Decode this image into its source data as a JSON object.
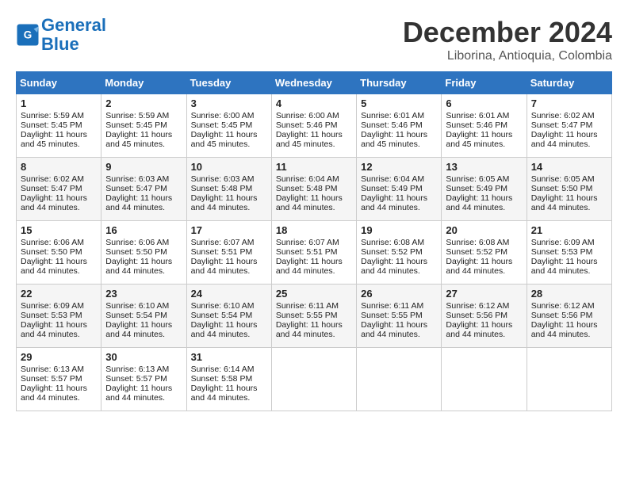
{
  "header": {
    "logo_line1": "General",
    "logo_line2": "Blue",
    "month_title": "December 2024",
    "location": "Liborina, Antioquia, Colombia"
  },
  "weekdays": [
    "Sunday",
    "Monday",
    "Tuesday",
    "Wednesday",
    "Thursday",
    "Friday",
    "Saturday"
  ],
  "weeks": [
    [
      {
        "day": "1",
        "lines": [
          "Sunrise: 5:59 AM",
          "Sunset: 5:45 PM",
          "Daylight: 11 hours",
          "and 45 minutes."
        ]
      },
      {
        "day": "2",
        "lines": [
          "Sunrise: 5:59 AM",
          "Sunset: 5:45 PM",
          "Daylight: 11 hours",
          "and 45 minutes."
        ]
      },
      {
        "day": "3",
        "lines": [
          "Sunrise: 6:00 AM",
          "Sunset: 5:45 PM",
          "Daylight: 11 hours",
          "and 45 minutes."
        ]
      },
      {
        "day": "4",
        "lines": [
          "Sunrise: 6:00 AM",
          "Sunset: 5:46 PM",
          "Daylight: 11 hours",
          "and 45 minutes."
        ]
      },
      {
        "day": "5",
        "lines": [
          "Sunrise: 6:01 AM",
          "Sunset: 5:46 PM",
          "Daylight: 11 hours",
          "and 45 minutes."
        ]
      },
      {
        "day": "6",
        "lines": [
          "Sunrise: 6:01 AM",
          "Sunset: 5:46 PM",
          "Daylight: 11 hours",
          "and 45 minutes."
        ]
      },
      {
        "day": "7",
        "lines": [
          "Sunrise: 6:02 AM",
          "Sunset: 5:47 PM",
          "Daylight: 11 hours",
          "and 44 minutes."
        ]
      }
    ],
    [
      {
        "day": "8",
        "lines": [
          "Sunrise: 6:02 AM",
          "Sunset: 5:47 PM",
          "Daylight: 11 hours",
          "and 44 minutes."
        ]
      },
      {
        "day": "9",
        "lines": [
          "Sunrise: 6:03 AM",
          "Sunset: 5:47 PM",
          "Daylight: 11 hours",
          "and 44 minutes."
        ]
      },
      {
        "day": "10",
        "lines": [
          "Sunrise: 6:03 AM",
          "Sunset: 5:48 PM",
          "Daylight: 11 hours",
          "and 44 minutes."
        ]
      },
      {
        "day": "11",
        "lines": [
          "Sunrise: 6:04 AM",
          "Sunset: 5:48 PM",
          "Daylight: 11 hours",
          "and 44 minutes."
        ]
      },
      {
        "day": "12",
        "lines": [
          "Sunrise: 6:04 AM",
          "Sunset: 5:49 PM",
          "Daylight: 11 hours",
          "and 44 minutes."
        ]
      },
      {
        "day": "13",
        "lines": [
          "Sunrise: 6:05 AM",
          "Sunset: 5:49 PM",
          "Daylight: 11 hours",
          "and 44 minutes."
        ]
      },
      {
        "day": "14",
        "lines": [
          "Sunrise: 6:05 AM",
          "Sunset: 5:50 PM",
          "Daylight: 11 hours",
          "and 44 minutes."
        ]
      }
    ],
    [
      {
        "day": "15",
        "lines": [
          "Sunrise: 6:06 AM",
          "Sunset: 5:50 PM",
          "Daylight: 11 hours",
          "and 44 minutes."
        ]
      },
      {
        "day": "16",
        "lines": [
          "Sunrise: 6:06 AM",
          "Sunset: 5:50 PM",
          "Daylight: 11 hours",
          "and 44 minutes."
        ]
      },
      {
        "day": "17",
        "lines": [
          "Sunrise: 6:07 AM",
          "Sunset: 5:51 PM",
          "Daylight: 11 hours",
          "and 44 minutes."
        ]
      },
      {
        "day": "18",
        "lines": [
          "Sunrise: 6:07 AM",
          "Sunset: 5:51 PM",
          "Daylight: 11 hours",
          "and 44 minutes."
        ]
      },
      {
        "day": "19",
        "lines": [
          "Sunrise: 6:08 AM",
          "Sunset: 5:52 PM",
          "Daylight: 11 hours",
          "and 44 minutes."
        ]
      },
      {
        "day": "20",
        "lines": [
          "Sunrise: 6:08 AM",
          "Sunset: 5:52 PM",
          "Daylight: 11 hours",
          "and 44 minutes."
        ]
      },
      {
        "day": "21",
        "lines": [
          "Sunrise: 6:09 AM",
          "Sunset: 5:53 PM",
          "Daylight: 11 hours",
          "and 44 minutes."
        ]
      }
    ],
    [
      {
        "day": "22",
        "lines": [
          "Sunrise: 6:09 AM",
          "Sunset: 5:53 PM",
          "Daylight: 11 hours",
          "and 44 minutes."
        ]
      },
      {
        "day": "23",
        "lines": [
          "Sunrise: 6:10 AM",
          "Sunset: 5:54 PM",
          "Daylight: 11 hours",
          "and 44 minutes."
        ]
      },
      {
        "day": "24",
        "lines": [
          "Sunrise: 6:10 AM",
          "Sunset: 5:54 PM",
          "Daylight: 11 hours",
          "and 44 minutes."
        ]
      },
      {
        "day": "25",
        "lines": [
          "Sunrise: 6:11 AM",
          "Sunset: 5:55 PM",
          "Daylight: 11 hours",
          "and 44 minutes."
        ]
      },
      {
        "day": "26",
        "lines": [
          "Sunrise: 6:11 AM",
          "Sunset: 5:55 PM",
          "Daylight: 11 hours",
          "and 44 minutes."
        ]
      },
      {
        "day": "27",
        "lines": [
          "Sunrise: 6:12 AM",
          "Sunset: 5:56 PM",
          "Daylight: 11 hours",
          "and 44 minutes."
        ]
      },
      {
        "day": "28",
        "lines": [
          "Sunrise: 6:12 AM",
          "Sunset: 5:56 PM",
          "Daylight: 11 hours",
          "and 44 minutes."
        ]
      }
    ],
    [
      {
        "day": "29",
        "lines": [
          "Sunrise: 6:13 AM",
          "Sunset: 5:57 PM",
          "Daylight: 11 hours",
          "and 44 minutes."
        ]
      },
      {
        "day": "30",
        "lines": [
          "Sunrise: 6:13 AM",
          "Sunset: 5:57 PM",
          "Daylight: 11 hours",
          "and 44 minutes."
        ]
      },
      {
        "day": "31",
        "lines": [
          "Sunrise: 6:14 AM",
          "Sunset: 5:58 PM",
          "Daylight: 11 hours",
          "and 44 minutes."
        ]
      },
      null,
      null,
      null,
      null
    ]
  ]
}
